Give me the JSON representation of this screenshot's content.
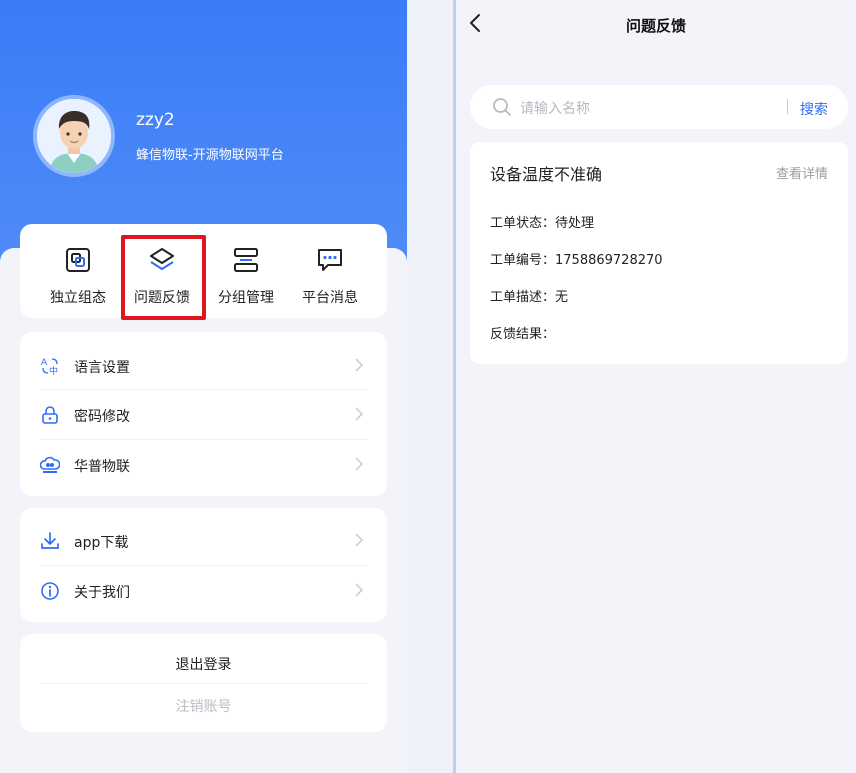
{
  "profile": {
    "username": "zzy2",
    "platform": "蜂信物联-开源物联网平台"
  },
  "quick_actions": [
    {
      "label": "独立组态",
      "icon": "grid-layers-icon"
    },
    {
      "label": "问题反馈",
      "icon": "layers-icon"
    },
    {
      "label": "分组管理",
      "icon": "group-icon"
    },
    {
      "label": "平台消息",
      "icon": "message-icon"
    }
  ],
  "menu_settings": [
    {
      "label": "语言设置",
      "icon": "language-icon"
    },
    {
      "label": "密码修改",
      "icon": "lock-icon"
    },
    {
      "label": "华普物联",
      "icon": "cloud-logo-icon"
    }
  ],
  "menu_more": [
    {
      "label": "app下载",
      "icon": "download-icon"
    },
    {
      "label": "关于我们",
      "icon": "info-icon"
    }
  ],
  "account": {
    "logout": "退出登录",
    "cancel": "注销账号"
  },
  "feedback_page": {
    "title": "问题反馈",
    "search_placeholder": "请输入名称",
    "search_button": "搜索",
    "order": {
      "title": "设备温度不准确",
      "detail_link": "查看详情",
      "status": "工单状态：待处理",
      "number": "工单编号：1758869728270",
      "description": "工单描述：无",
      "result": "反馈结果："
    }
  },
  "colors": {
    "brand_blue": "#3a7cf8",
    "highlight_red": "#e0151f",
    "link_blue": "#2f6df6"
  }
}
